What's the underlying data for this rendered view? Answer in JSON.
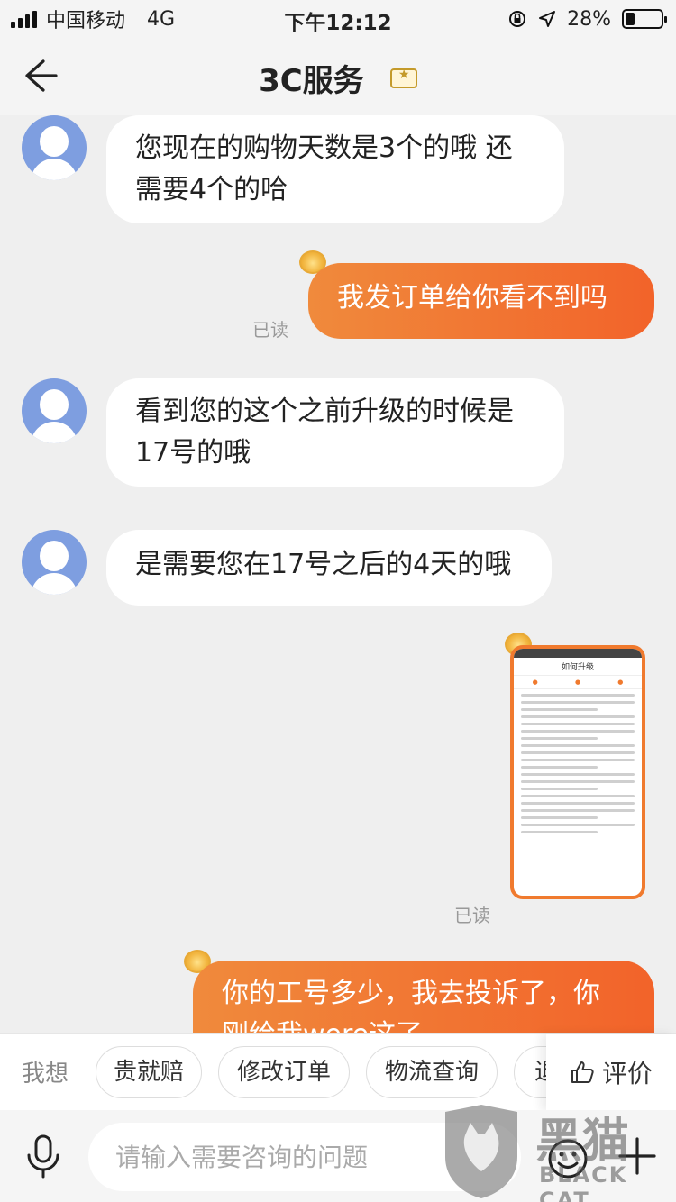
{
  "status": {
    "carrier": "中国移动",
    "network": "4G",
    "time": "下午12:12",
    "battery": "28%",
    "battery_level": 0.28
  },
  "header": {
    "title": "3C服务"
  },
  "messages": [
    {
      "side": "left",
      "text": "您现在的购物天数是3个的哦 还需要4个的哈"
    },
    {
      "side": "right",
      "text": "我发订单给你看不到吗",
      "read": "已读"
    },
    {
      "side": "left",
      "text": "看到您的这个之前升级的时候是17号的哦"
    },
    {
      "side": "left",
      "text": "是需要您在17号之后的4天的哦"
    },
    {
      "side": "right",
      "type": "image",
      "read": "已读",
      "image_title": "如何升级"
    },
    {
      "side": "right",
      "text": "你的工号多少，我去投诉了，你刚给我were这了"
    }
  ],
  "quick": {
    "label": "我想",
    "chips": [
      "贵就赔",
      "修改订单",
      "物流查询",
      "退"
    ],
    "rate": "评价"
  },
  "input": {
    "placeholder": "请输入需要咨询的问题"
  },
  "watermark": {
    "cn": "黑猫",
    "en": "BLACK CAT"
  },
  "colors": {
    "accent": "#f2632a",
    "accent_start": "#f08a3c",
    "avatar": "#7e9ee0"
  }
}
